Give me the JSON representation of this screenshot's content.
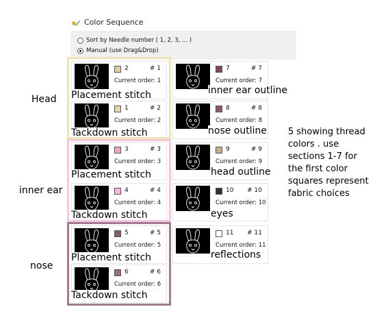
{
  "window": {
    "title": "Color Sequence",
    "icon": "palette-icon"
  },
  "sort_options": [
    {
      "label": "Sort by Needle number ( 1, 2, 3, ... )",
      "selected": false
    },
    {
      "label": "Manual (use Drag&Drop)",
      "selected": true
    }
  ],
  "left_cards": [
    {
      "needle": "2",
      "hash": "# 1",
      "order": "Current order: 1",
      "swatch": "#e3cda4",
      "label": "Placement stitch"
    },
    {
      "needle": "1",
      "hash": "# 2",
      "order": "Current order: 2",
      "swatch": "#e8d5b0",
      "label": "Tackdown stitch"
    },
    {
      "needle": "3",
      "hash": "# 3",
      "order": "Current order: 3",
      "swatch": "#f2a6c8",
      "label": "Placement stitch"
    },
    {
      "needle": "4",
      "hash": "# 4",
      "order": "Current order: 4",
      "swatch": "#f7b4e4",
      "label": "Tackdown stitch"
    },
    {
      "needle": "5",
      "hash": "# 5",
      "order": "Current order: 5",
      "swatch": "#8c5a6e",
      "label": "Placement stitch"
    },
    {
      "needle": "6",
      "hash": "# 6",
      "order": "Current order: 6",
      "swatch": "#9a6e80",
      "label": "Tackdown stitch"
    }
  ],
  "right_cards": [
    {
      "needle": "7",
      "hash": "# 7",
      "order": "Current order: 7",
      "swatch": "#7d4a5a",
      "label": "inner ear outline"
    },
    {
      "needle": "8",
      "hash": "# 8",
      "order": "Current order: 8",
      "swatch": "#8a5a6e",
      "label": "nose outline"
    },
    {
      "needle": "9",
      "hash": "# 9",
      "order": "Current order: 9",
      "swatch": "#c9ad8a",
      "label": "head outline"
    },
    {
      "needle": "10",
      "hash": "# 10",
      "order": "Current order: 10",
      "swatch": "#333333",
      "label": "eyes"
    },
    {
      "needle": "11",
      "hash": "# 11",
      "order": "Current order: 11",
      "swatch": "#ffffff",
      "label": "reflections"
    }
  ],
  "group_labels": {
    "head": "Head",
    "inner_ear": "inner ear",
    "nose": "nose"
  },
  "group_colors": {
    "head": "#efe4b8",
    "inner_ear": "#f3c8dc",
    "nose": "#a07a90"
  },
  "note_lines": [
    "5 showing thread",
    "colors . use",
    "sections 1-7 for",
    "the first color",
    "squares represent",
    "fabric choices"
  ]
}
